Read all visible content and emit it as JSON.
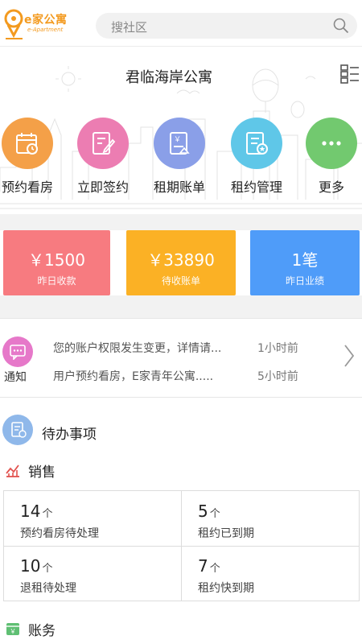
{
  "header": {
    "logo_name": "e家公寓",
    "logo_sub": "e-Apartment",
    "search_placeholder": "搜社区"
  },
  "banner": {
    "title": "君临海岸公寓"
  },
  "quick_actions": [
    {
      "label": "预约看房",
      "color": "#f4a048",
      "icon": "calendar-icon"
    },
    {
      "label": "立即签约",
      "color": "#ec7db2",
      "icon": "sign-contract-icon"
    },
    {
      "label": "租期账单",
      "color": "#8a9fe8",
      "icon": "bill-icon"
    },
    {
      "label": "租约管理",
      "color": "#5fc7e8",
      "icon": "lease-manage-icon"
    },
    {
      "label": "更多",
      "color": "#72c96f",
      "icon": "more-icon"
    }
  ],
  "stats": [
    {
      "value": "￥1500",
      "label": "昨日收款",
      "color": "#f77b80"
    },
    {
      "value": "￥33890",
      "label": "待收账单",
      "color": "#fbb125"
    },
    {
      "value": "1笔",
      "label": "昨日业绩",
      "color": "#4f9cf9"
    }
  ],
  "notice": {
    "label": "通知",
    "items": [
      {
        "text": "您的账户权限发生变更，详情请...",
        "time": "1小时前"
      },
      {
        "text": "用户预约看房，E家青年公寓.....",
        "time": "5小时前"
      }
    ]
  },
  "todo": {
    "title": "待办事项",
    "sales": {
      "title": "销售",
      "cells": [
        {
          "num": "14",
          "unit": "个",
          "label": "预约看房待处理"
        },
        {
          "num": "5",
          "unit": "个",
          "label": "租约已到期"
        },
        {
          "num": "10",
          "unit": "个",
          "label": "退租待处理"
        },
        {
          "num": "7",
          "unit": "个",
          "label": "租约快到期"
        }
      ]
    },
    "finance": {
      "title": "账务"
    }
  }
}
